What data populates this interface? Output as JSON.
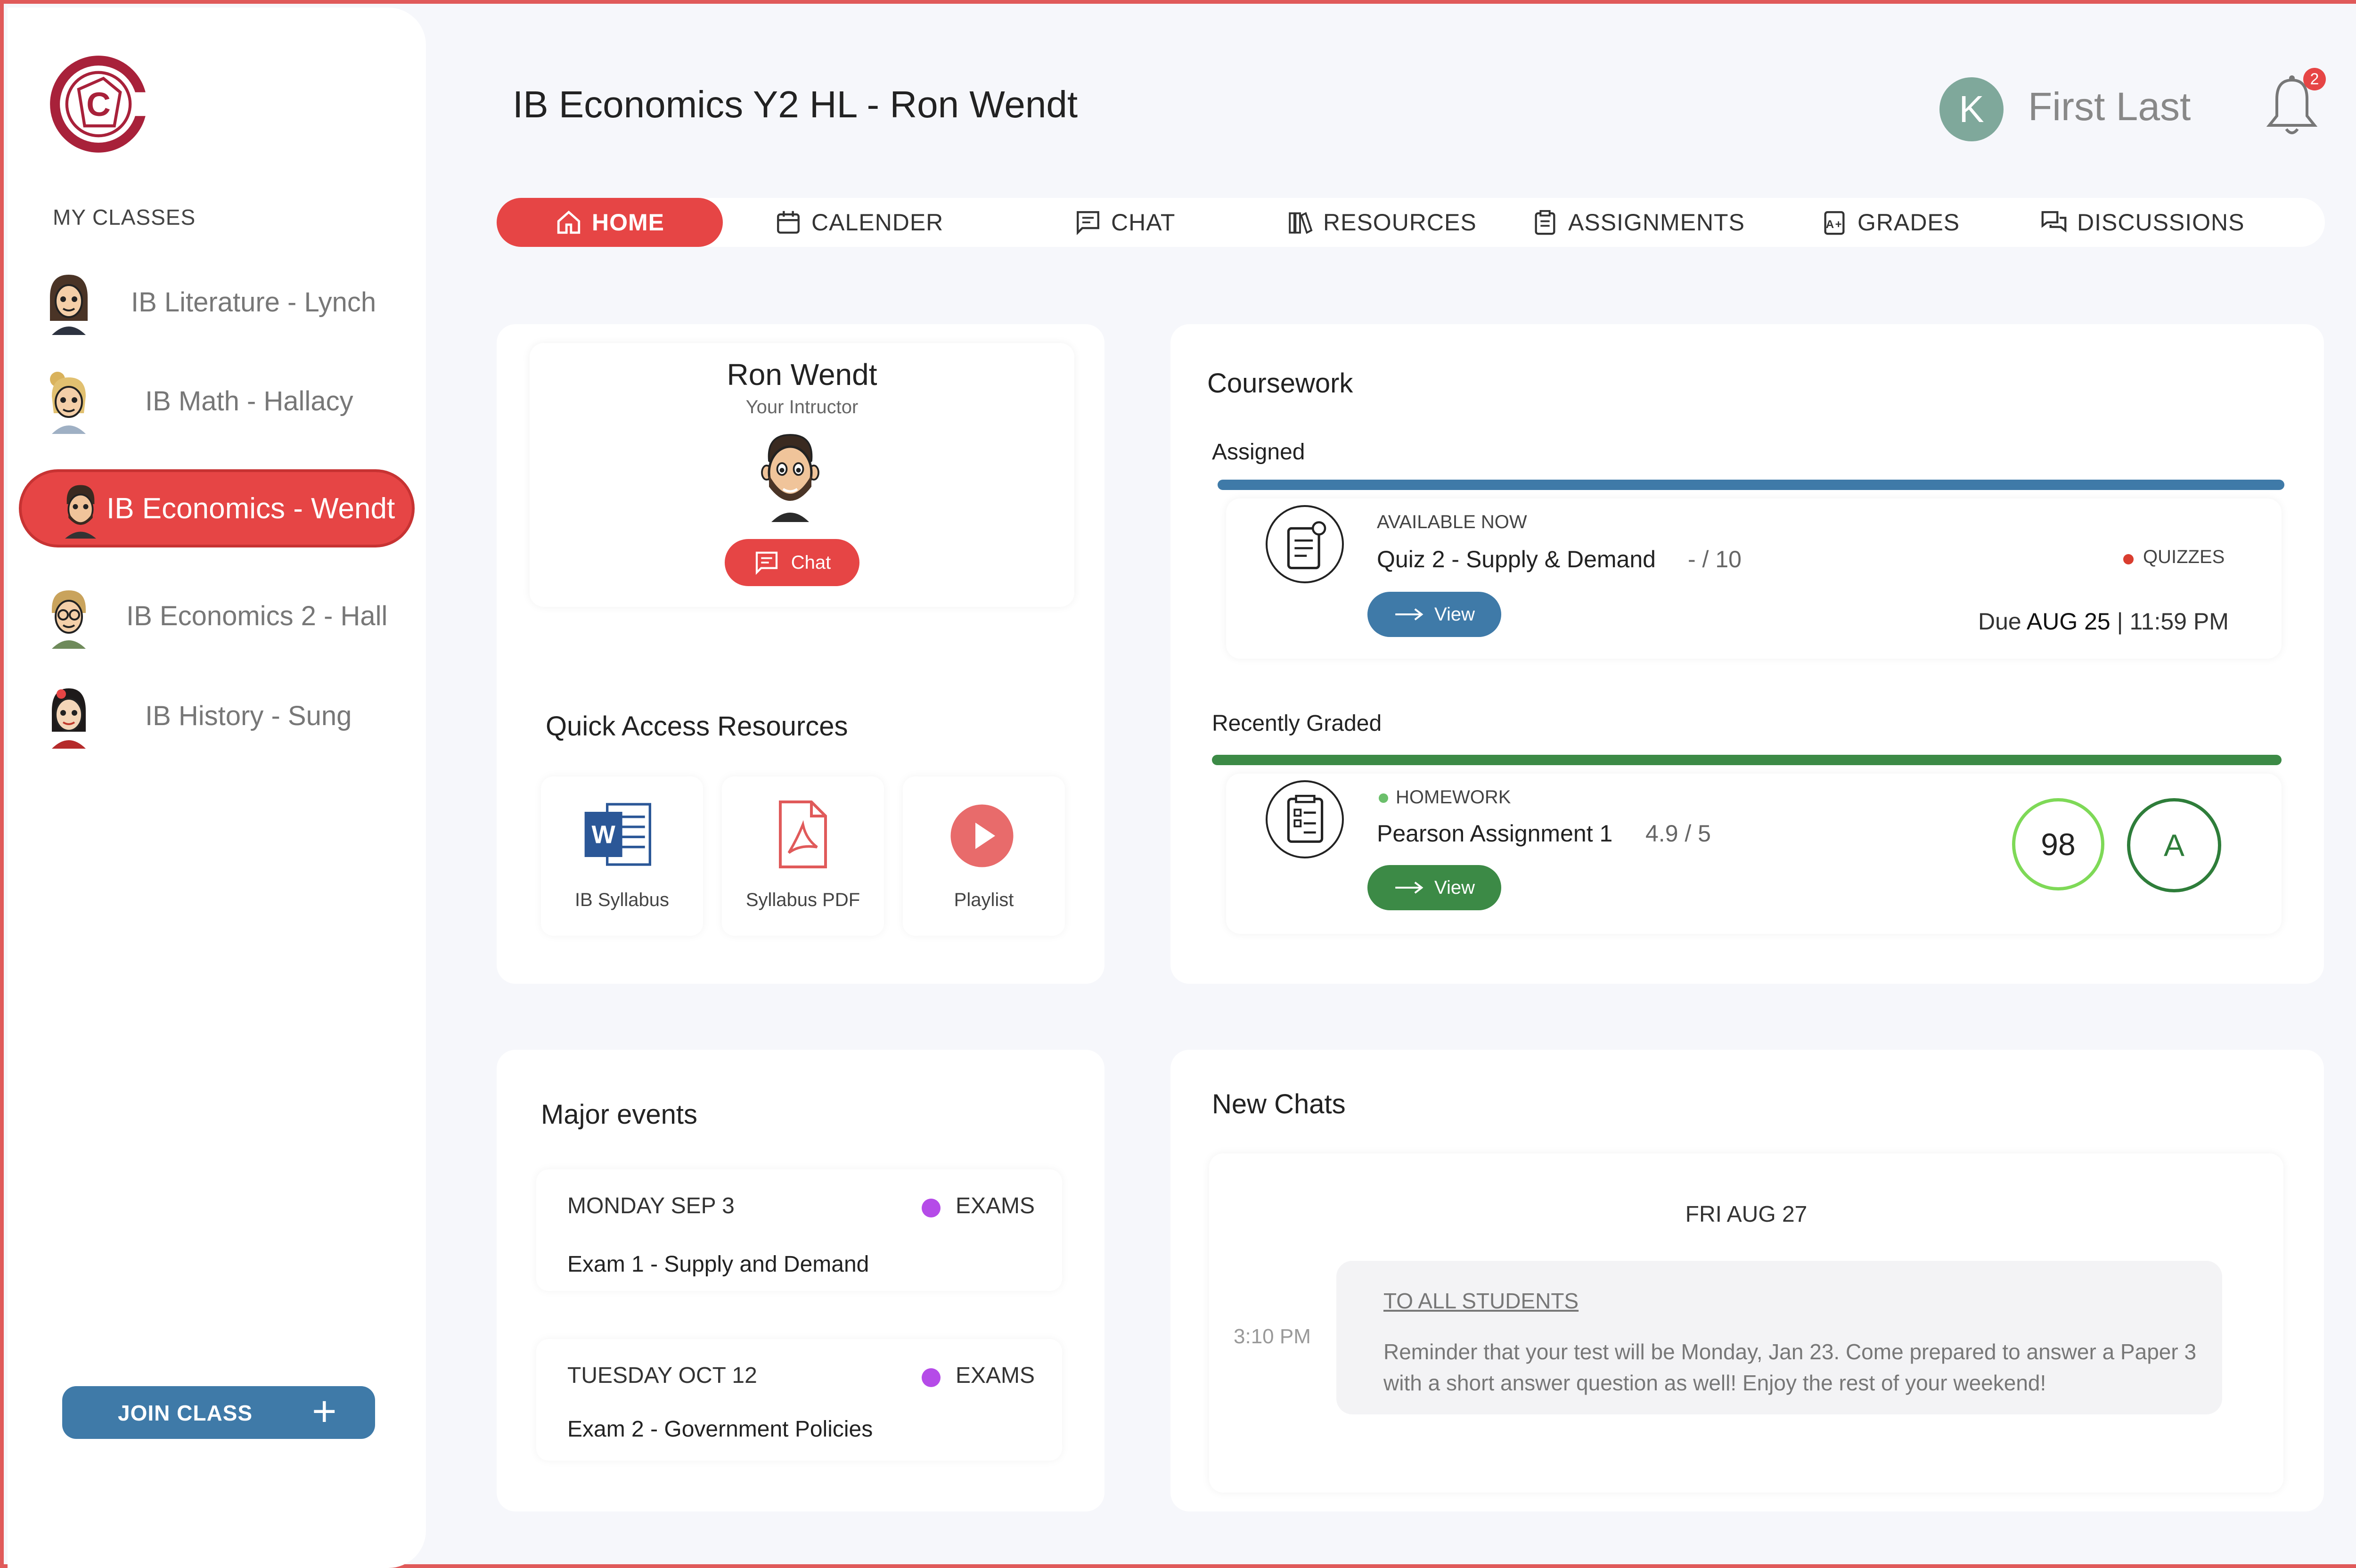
{
  "app": {
    "title": "IB Economics Y2 HL - Ron Wendt"
  },
  "sidebar": {
    "heading": "MY CLASSES",
    "classes": [
      {
        "label": "IB Literature - Lynch"
      },
      {
        "label": "IB Math - Hallacy"
      },
      {
        "label": "IB Economics - Wendt"
      },
      {
        "label": "IB Economics 2 - Hall"
      },
      {
        "label": "IB History - Sung"
      }
    ],
    "join_label": "JOIN CLASS",
    "join_icon": "+"
  },
  "header": {
    "user_initial": "K",
    "user_name": "First Last",
    "notification_count": "2"
  },
  "nav": {
    "tabs": [
      {
        "label": "HOME",
        "icon": "home-icon"
      },
      {
        "label": "CALENDER",
        "icon": "calendar-icon"
      },
      {
        "label": "CHAT",
        "icon": "chat-icon"
      },
      {
        "label": "RESOURCES",
        "icon": "books-icon"
      },
      {
        "label": "ASSIGNMENTS",
        "icon": "clipboard-icon"
      },
      {
        "label": "GRADES",
        "icon": "grade-icon"
      },
      {
        "label": "DISCUSSIONS",
        "icon": "discussion-icon"
      }
    ],
    "active": "HOME"
  },
  "instructor": {
    "name": "Ron Wendt",
    "role": "Your Intructor",
    "chat_label": "Chat"
  },
  "resources": {
    "title": "Quick Access Resources",
    "items": [
      {
        "label": "IB Syllabus",
        "icon": "word-doc-icon"
      },
      {
        "label": "Syllabus PDF",
        "icon": "pdf-icon"
      },
      {
        "label": "Playlist",
        "icon": "play-icon"
      }
    ]
  },
  "coursework": {
    "title": "Coursework",
    "assigned": {
      "heading": "Assigned",
      "status": "AVAILABLE NOW",
      "name": "Quiz 2 - Supply & Demand",
      "score": "- / 10",
      "category": "QUIZZES",
      "view_label": "View",
      "due_prefix": "Due",
      "due_date": "AUG 25",
      "due_sep": "|",
      "due_time": "11:59 PM"
    },
    "graded": {
      "heading": "Recently Graded",
      "category": "HOMEWORK",
      "name": "Pearson Assignment 1",
      "score": "4.9 / 5",
      "view_label": "View",
      "percent": "98",
      "letter": "A"
    }
  },
  "events": {
    "title": "Major events",
    "items": [
      {
        "date": "MONDAY SEP 3",
        "tag": "EXAMS",
        "title": "Exam 1 - Supply and Demand"
      },
      {
        "date": "TUESDAY OCT 12",
        "tag": "EXAMS",
        "title": "Exam 2 - Government Policies"
      }
    ]
  },
  "chats": {
    "title": "New Chats",
    "date": "FRI AUG 27",
    "time": "3:10 PM",
    "recipient": "TO ALL STUDENTS",
    "message": "Reminder that your test will be Monday, Jan 23. Come prepared to answer a Paper 3 with a short answer question as well! Enjoy the rest of your weekend!"
  },
  "colors": {
    "accent": "#e64545",
    "blue": "#3f7aa8",
    "green": "#3c8a46",
    "exam_dot": "#b54be8",
    "avatar": "#7fa89b"
  }
}
